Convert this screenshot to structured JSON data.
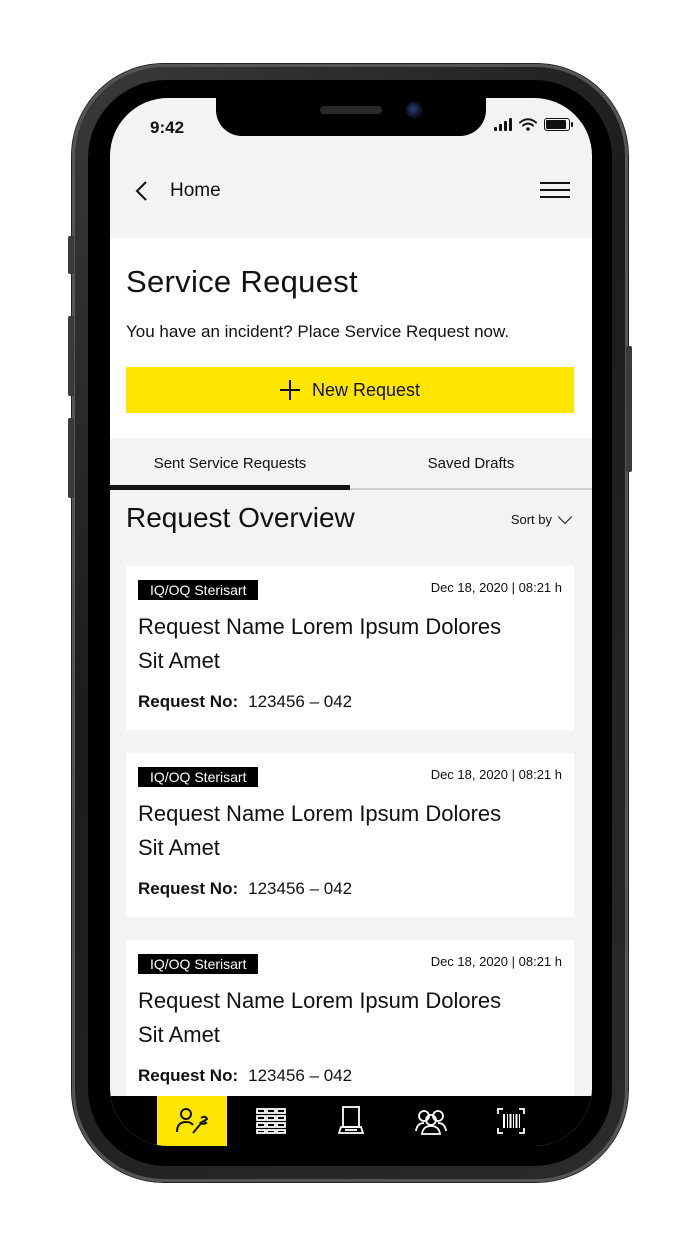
{
  "status": {
    "time": "9:42"
  },
  "topbar": {
    "back_label": "Home"
  },
  "hero": {
    "title": "Service Request",
    "subtitle": "You have an incident? Place Service Request now.",
    "new_button_label": "New Request"
  },
  "tabs": [
    {
      "label": "Sent Service Requests",
      "active": true
    },
    {
      "label": "Saved Drafts",
      "active": false
    }
  ],
  "overview": {
    "title": "Request Overview",
    "sort_label": "Sort by"
  },
  "requests": [
    {
      "tag": "IQ/OQ Sterisart",
      "date": "Dec 18, 2020 | 08:21 h",
      "name": "Request Name Lorem Ipsum Dolores Sit Amet",
      "no_label": "Request No:",
      "no_value": "123456 – 042"
    },
    {
      "tag": "IQ/OQ Sterisart",
      "date": "Dec 18, 2020 | 08:21 h",
      "name": "Request Name Lorem Ipsum Dolores Sit Amet",
      "no_label": "Request No:",
      "no_value": "123456 – 042"
    },
    {
      "tag": "IQ/OQ Sterisart",
      "date": "Dec 18, 2020 | 08:21 h",
      "name": "Request Name Lorem Ipsum Dolores Sit Amet",
      "no_label": "Request No:",
      "no_value": "123456 – 042"
    }
  ],
  "bottom_nav": [
    {
      "icon": "service-tools-icon",
      "active": true
    },
    {
      "icon": "grid-list-icon",
      "active": false
    },
    {
      "icon": "device-icon",
      "active": false
    },
    {
      "icon": "group-icon",
      "active": false
    },
    {
      "icon": "barcode-icon",
      "active": false
    }
  ],
  "colors": {
    "accent": "#ffe600",
    "background": "#f3f3f3",
    "card": "#ffffff",
    "text": "#111111"
  }
}
